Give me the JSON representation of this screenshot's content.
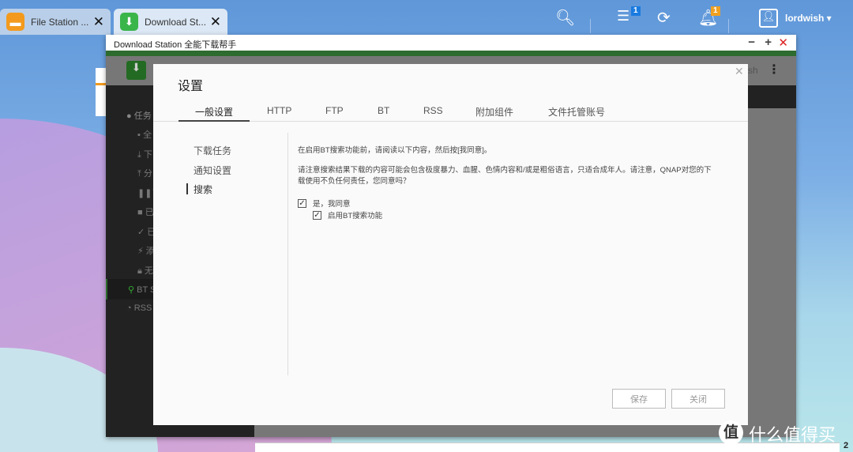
{
  "taskbar": {
    "tabs": [
      {
        "label": "File Station ...",
        "icon": "folder-icon",
        "color": "#f39a1e"
      },
      {
        "label": "Download St...",
        "icon": "download-icon",
        "color": "#3ab54a"
      }
    ],
    "user": "lordwish ▾",
    "badges": {
      "background_tasks": "1",
      "notifications": "1"
    }
  },
  "window": {
    "title": "Download Station 全能下载帮手",
    "accent": "#2e6b2e"
  },
  "sidebar": {
    "items": [
      "任务",
      "全",
      "下",
      "分",
      "已",
      "已",
      "已",
      "添",
      "无",
      "BT S",
      "RSS"
    ]
  },
  "header_partial": "sh",
  "modal": {
    "title": "设置",
    "tabs": [
      "一般设置",
      "HTTP",
      "FTP",
      "BT",
      "RSS",
      "附加组件",
      "文件托管账号"
    ],
    "nav": [
      "下载任务",
      "通知设置",
      "搜索"
    ],
    "intro": "在启用BT搜索功能前，请阅读以下内容，然后按[我同意]。",
    "warning": "请注意搜索结果下载的内容可能会包含极度暴力、血腥、色情内容和/或是粗俗语言，只适合成年人。请注意，QNAP对您的下载使用不负任何责任，您同意吗？",
    "agree": {
      "label": "是，我同意",
      "checked": true
    },
    "enable_bt": {
      "label": "启用BT搜索功能",
      "checked": true
    },
    "save": "保存",
    "close": "关闭"
  },
  "watermark": "什么值得买",
  "watermark_logo": "值",
  "corner_text": "2"
}
